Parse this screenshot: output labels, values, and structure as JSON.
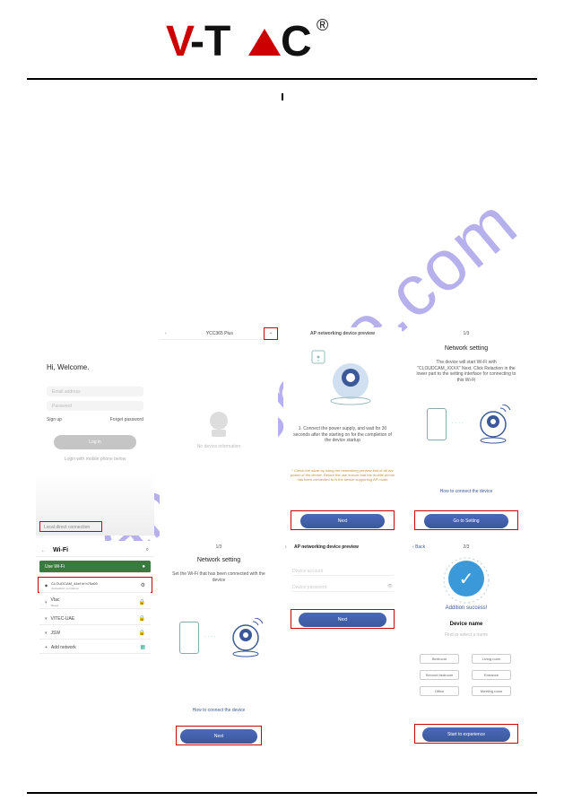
{
  "brand": {
    "name": "V-TAC",
    "reg": "®"
  },
  "watermark": "manualshive.com",
  "tiles": {
    "login": {
      "title": "Hi, Welcome.",
      "email_ph": "Email address",
      "pwd_ph": "Password",
      "signup": "Sign up",
      "forgot": "Forget password",
      "login_btn": "Log in",
      "mobile_login": "Login with mobile phone below",
      "local_conn": "Local direct connection"
    },
    "ycc": {
      "title": "YCC365 Plus",
      "empty": "No device information"
    },
    "ap1": {
      "title": "AP networking device preview",
      "step_text": "1. Connect the power supply, and wait for 30 seconds after the starting on for the completion of the device startup",
      "warn": "* Check the wizar by using the networking preview first of all live poster of the device. Before the use ensure that the mobile phone has been connected to N the device supporting AP mode",
      "next": "Next"
    },
    "net1": {
      "step": "1/3",
      "title": "Network setting",
      "desc": "The device will start Wi-Fi with \"CLOUDCAM_XXXX\" Next, Click Relaction in the lower part to the setting interface for connecting to this Wi-Fi",
      "hint": "How to connect the device",
      "go": "Go to Setting"
    },
    "wifi": {
      "title": "Wi-Fi",
      "use": "Use Wi-Fi",
      "ssid1": "CLOUDCAM_44ef bf b75a90",
      "ssid1_sub": "Connected, no Internet",
      "ssid2": "Vtac",
      "ssid2_sub": "Saved",
      "ssid3": "VITEC-UAE",
      "ssid4": "JSW",
      "add": "Add network"
    },
    "net2": {
      "step": "1/3",
      "title": "Network setting",
      "desc": "Set the Wi-Fi that has been connected with the device",
      "hint": "How to connect the device",
      "next": "Next"
    },
    "ap2": {
      "title": "AP networking device preview",
      "acct_ph": "Device account",
      "pwd_ph": "Device password",
      "next": "Next"
    },
    "done": {
      "back": "Back",
      "step": "2/3",
      "success": "Addition success!",
      "dev_name": "Device name",
      "hint": "Find or select a name",
      "rooms": [
        "Bedroom",
        "Living room",
        "Second bedroom",
        "Entrance",
        "Office",
        "Meeting room"
      ],
      "start": "Start to experience"
    }
  }
}
